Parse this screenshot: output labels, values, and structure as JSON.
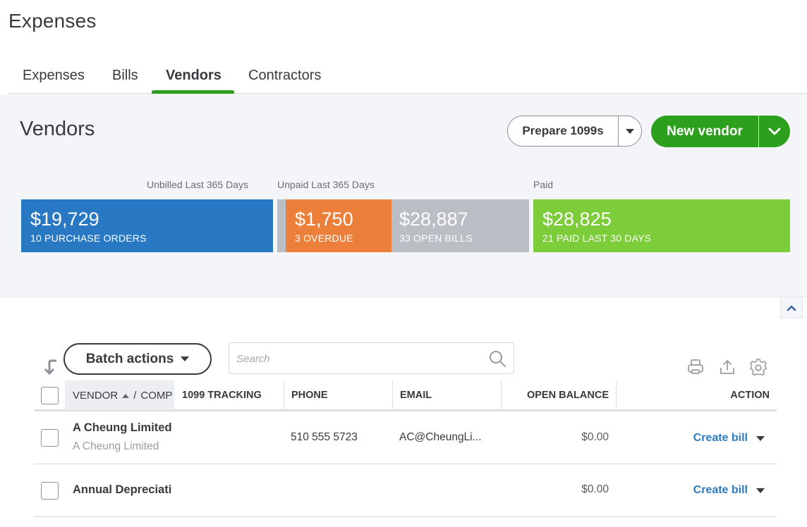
{
  "page": {
    "title": "Expenses"
  },
  "tabs": [
    {
      "label": "Expenses",
      "active": false
    },
    {
      "label": "Bills",
      "active": false
    },
    {
      "label": "Vendors",
      "active": true
    },
    {
      "label": "Contractors",
      "active": false
    }
  ],
  "summary": {
    "title": "Vendors",
    "prepare_label": "Prepare 1099s",
    "new_vendor_label": "New vendor",
    "labels": {
      "unbilled": "Unbilled Last 365 Days",
      "unpaid": "Unpaid Last 365 Days",
      "paid": "Paid"
    },
    "bars": [
      {
        "key": "purchase_orders",
        "amount": "$19,729",
        "sub": "10 PURCHASE ORDERS",
        "color": "#2878c4"
      },
      {
        "key": "overdue",
        "amount": "$1,750",
        "sub": "3 OVERDUE",
        "color": "#ec803b"
      },
      {
        "key": "open_bills",
        "amount": "$28,887",
        "sub": "33 OPEN BILLS",
        "color": "#babec5"
      },
      {
        "key": "paid",
        "amount": "$28,825",
        "sub": "21 PAID LAST 30 DAYS",
        "color": "#7dcc39"
      }
    ]
  },
  "toolbar": {
    "batch_label": "Batch actions",
    "search_placeholder": "Search",
    "search_value": ""
  },
  "table": {
    "columns": {
      "vendor": "VENDOR",
      "vendor_sep": "/",
      "company": "COMP",
      "tracking": "1099 TRACKING",
      "phone": "PHONE",
      "email": "EMAIL",
      "balance": "OPEN BALANCE",
      "action": "ACTION"
    },
    "rows": [
      {
        "name": "A Cheung Limited",
        "company": "A Cheung Limited",
        "tracking": "",
        "phone": "510 555 5723",
        "email": "AC@CheungLi...",
        "balance": "$0.00",
        "action": "Create bill"
      },
      {
        "name": "Annual Depreciati",
        "company": "",
        "tracking": "",
        "phone": "",
        "email": "",
        "balance": "$0.00",
        "action": "Create bill"
      }
    ]
  },
  "colors": {
    "brand_green": "#2ca01c",
    "link_blue": "#2e7bbf"
  }
}
